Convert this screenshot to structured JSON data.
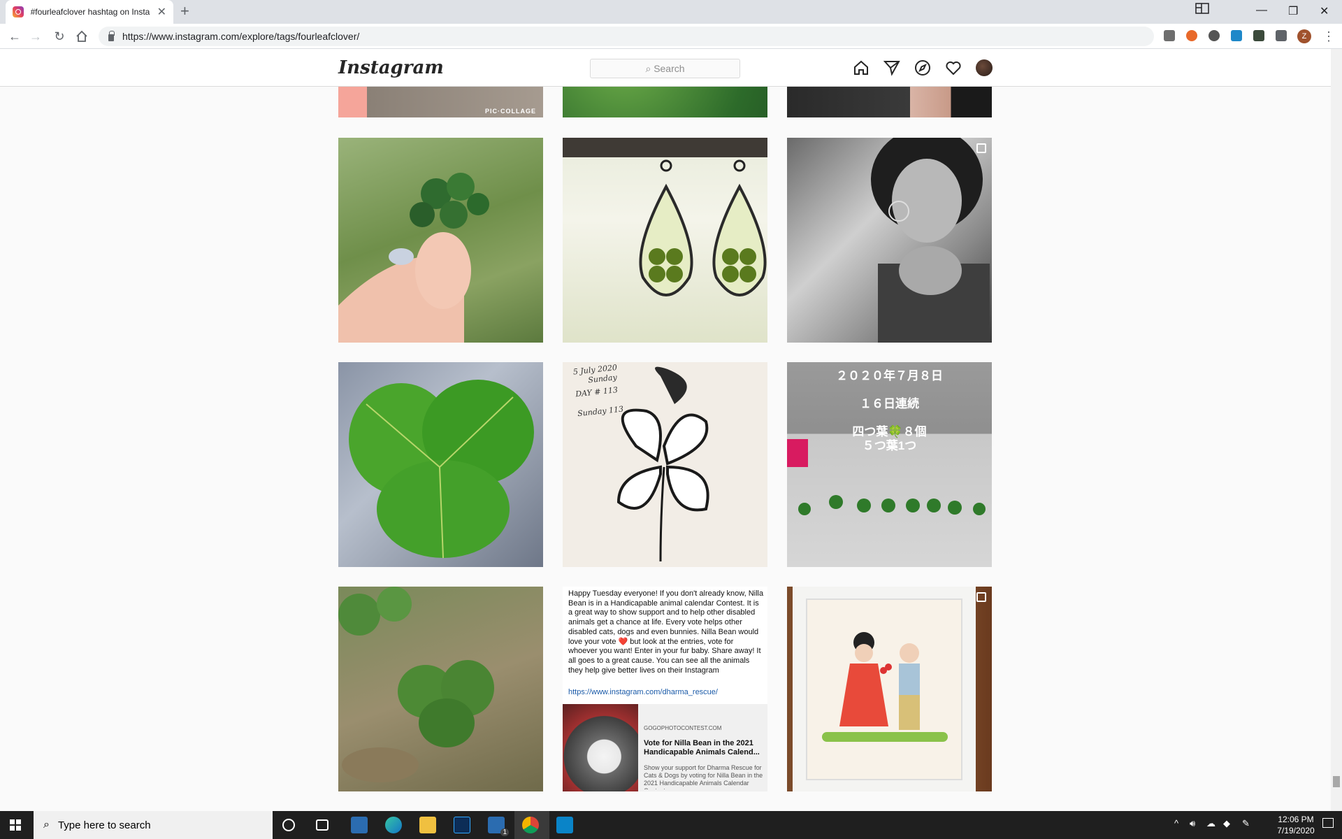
{
  "browser": {
    "tab_title": "#fourleafclover hashtag on Insta",
    "url": "https://www.instagram.com/explore/tags/fourleafclover/",
    "profile_initial": "Z"
  },
  "instagram": {
    "logo": "Instagram",
    "search_placeholder": "Search"
  },
  "tiles": {
    "picollage": "PIC·COLLAGE",
    "japanese": [
      "２０２０年７月８日",
      "１６日連続",
      "四つ葉🍀８個",
      "５つ葉1つ"
    ],
    "sketch": [
      "5 July 2020",
      "Sunday",
      "DAY # 113",
      "Sunday 113"
    ],
    "post_text": "Happy Tuesday everyone! If you don't already know, Nilla Bean is in a Handicapable animal calendar Contest. It is a great way to show support and to help other disabled animals get a chance at life. Every vote helps other disabled cats, dogs and even bunnies. Nilla Bean would love your vote ❤️ but look at the entries, vote for whoever you want! Enter in your fur baby. Share away! It all goes to a great cause.  You can see all the animals they help give better lives on their Instagram",
    "post_link": "https://www.instagram.com/dharma_rescue/",
    "card_domain": "GOGOPHOTOCONTEST.COM",
    "card_title": "Vote for Nilla Bean in the 2021 Handicapable Animals Calend...",
    "card_desc": "Show your support for Dharma Rescue for Cats & Dogs by voting for Nilla Bean in the 2021 Handicapable Animals Calendar Contest"
  },
  "taskbar": {
    "search_placeholder": "Type here to search",
    "time": "12:06 PM",
    "date": "7/19/2020",
    "mail_badge": "1"
  }
}
